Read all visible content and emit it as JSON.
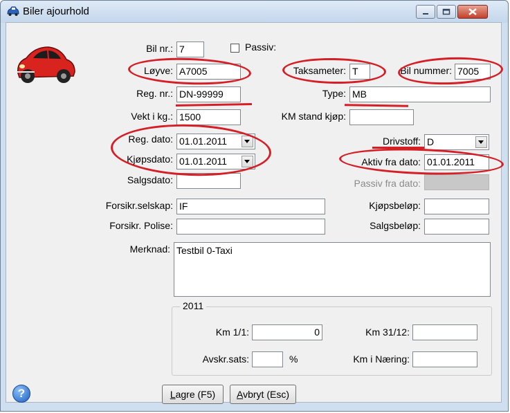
{
  "window": {
    "title": "Biler ajourhold"
  },
  "fields": {
    "bil_nr": {
      "label": "Bil nr.:",
      "value": "7"
    },
    "passiv": {
      "label": "Passiv:",
      "checked": false
    },
    "loyve": {
      "label": "Løyve:",
      "value": "A7005"
    },
    "taksameter": {
      "label": "Taksameter:",
      "value": "T"
    },
    "bil_nummer": {
      "label": "Bil nummer:",
      "value": "7005"
    },
    "reg_nr": {
      "label": "Reg. nr.:",
      "value": "DN-99999"
    },
    "type": {
      "label": "Type:",
      "value": "MB"
    },
    "vekt": {
      "label": "Vekt i kg.:",
      "value": "1500"
    },
    "km_stand_kjop": {
      "label": "KM stand kjøp:",
      "value": ""
    },
    "reg_dato": {
      "label": "Reg. dato:",
      "value": "01.01.2011"
    },
    "drivstoff": {
      "label": "Drivstoff:",
      "value": "D"
    },
    "kjopsdato": {
      "label": "Kjøpsdato:",
      "value": "01.01.2011"
    },
    "aktiv_fra_dato": {
      "label": "Aktiv fra dato:",
      "value": "01.01.2011"
    },
    "salgsdato": {
      "label": "Salgsdato:",
      "value": ""
    },
    "passiv_fra_dato": {
      "label": "Passiv fra dato:",
      "value": ""
    },
    "forsikr_selskap": {
      "label": "Forsikr.selskap:",
      "value": "IF"
    },
    "kjopsbelop": {
      "label": "Kjøpsbeløp:",
      "value": ""
    },
    "forsikr_polise": {
      "label": "Forsikr. Polise:",
      "value": ""
    },
    "salgsbelop": {
      "label": "Salgsbeløp:",
      "value": ""
    },
    "merknad": {
      "label": "Merknad:",
      "value": "Testbil 0-Taxi"
    }
  },
  "year_group": {
    "title": "2011",
    "km_1_1": {
      "label": "Km 1/1:",
      "value": "0"
    },
    "km_31_12": {
      "label": "Km 31/12:",
      "value": ""
    },
    "avskr_sats": {
      "label": "Avskr.sats:",
      "value": "",
      "unit": "%"
    },
    "km_i_naering": {
      "label": "Km i Næring:",
      "value": ""
    }
  },
  "buttons": {
    "lagre": {
      "mnemonic": "L",
      "rest": "agre (F5)"
    },
    "avbryt": {
      "mnemonic": "A",
      "rest": "vbryt (Esc)"
    },
    "help": "?"
  },
  "colors": {
    "annotation": "#d41f26",
    "titlebar": "#c3d6ec",
    "close": "#c2412c"
  }
}
